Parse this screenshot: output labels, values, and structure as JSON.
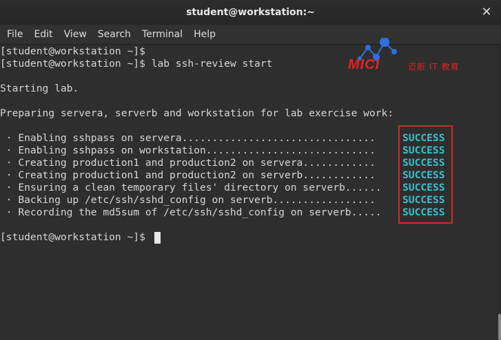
{
  "window": {
    "title": "student@workstation:~",
    "close_glyph": "✕"
  },
  "menu": [
    "File",
    "Edit",
    "View",
    "Search",
    "Terminal",
    "Help"
  ],
  "terminal": {
    "lines": [
      "[student@workstation ~]$",
      "[student@workstation ~]$ lab ssh-review start",
      "",
      "Starting lab.",
      "",
      "Preparing servera, serverb and workstation for lab exercise work:",
      "",
      " · Enabling sshpass on servera................................",
      " · Enabling sshpass on workstation............................",
      " · Creating production1 and production2 on servera............",
      " · Creating production1 and production2 on serverb............",
      " · Ensuring a clean temporary files' directory on serverb......",
      " · Backing up /etc/ssh/sshd_config on serverb.................",
      " · Recording the md5sum of /etc/ssh/sshd_config on serverb.....",
      "",
      "[student@workstation ~]$"
    ],
    "statuses": [
      "SUCCESS",
      "SUCCESS",
      "SUCCESS",
      "SUCCESS",
      "SUCCESS",
      "SUCCESS",
      "SUCCESS"
    ]
  },
  "watermark": {
    "brand": "MICI",
    "subtitle": "迈斯 IT 教育"
  },
  "colors": {
    "status": "#37c3cf",
    "highlight_box": "#d42a2a",
    "watermark": "#e8231f"
  }
}
